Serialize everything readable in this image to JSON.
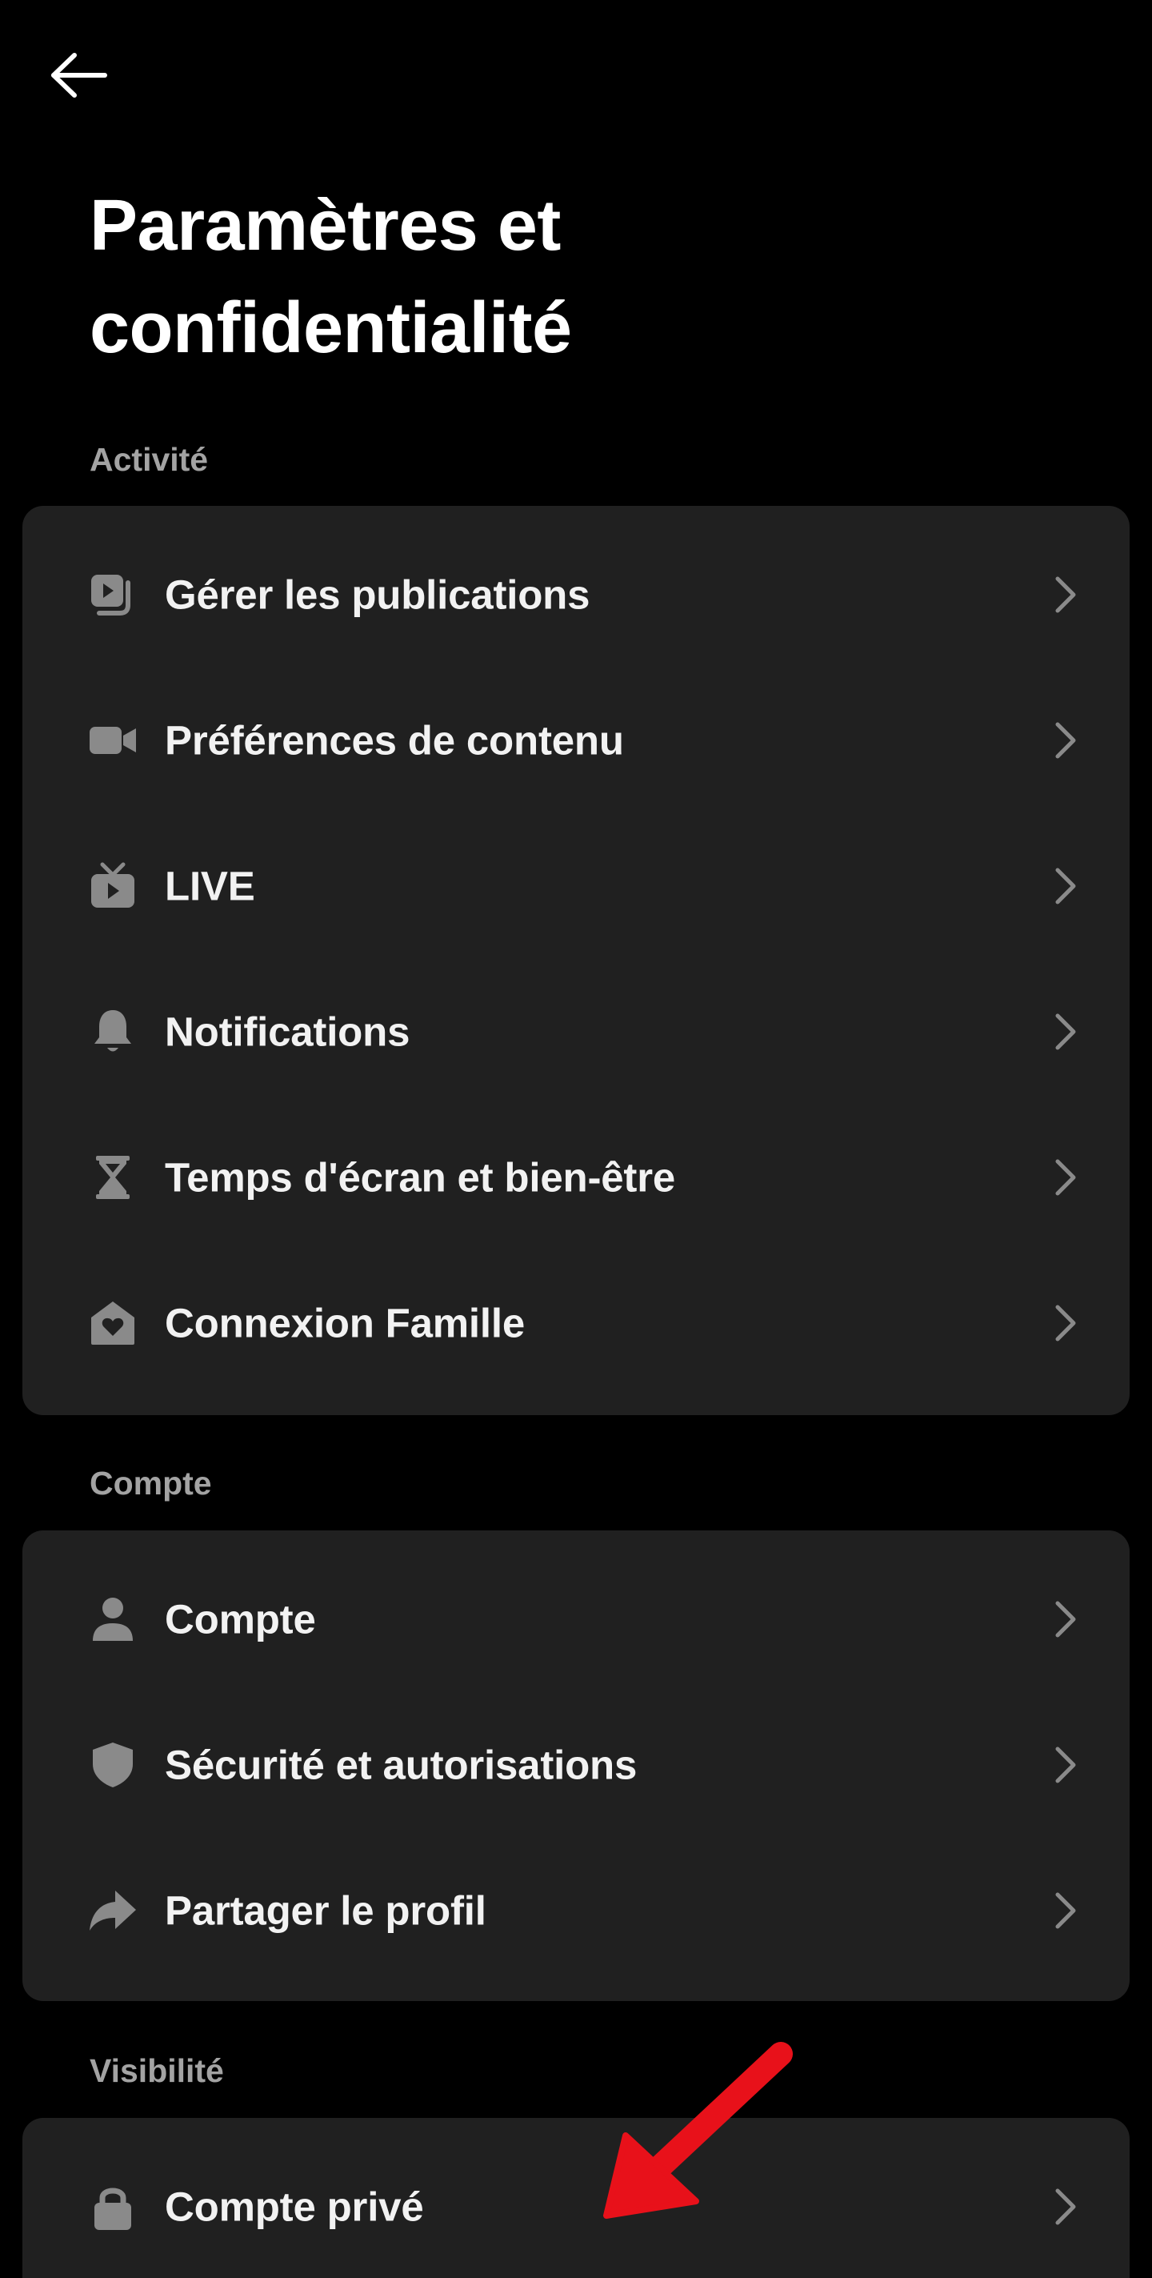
{
  "header": {
    "back_icon": "arrow-left-icon",
    "title": "Paramètres et confidentialité"
  },
  "sections": [
    {
      "label": "Activité",
      "items": [
        {
          "label": "Gérer les publications",
          "icon": "manage-posts-icon"
        },
        {
          "label": "Préférences de contenu",
          "icon": "video-camera-icon"
        },
        {
          "label": "LIVE",
          "icon": "tv-icon"
        },
        {
          "label": "Notifications",
          "icon": "bell-icon"
        },
        {
          "label": "Temps d'écran et bien-être",
          "icon": "hourglass-icon"
        },
        {
          "label": "Connexion Famille",
          "icon": "family-home-icon"
        }
      ]
    },
    {
      "label": "Compte",
      "items": [
        {
          "label": "Compte",
          "icon": "person-icon"
        },
        {
          "label": "Sécurité et autorisations",
          "icon": "shield-icon"
        },
        {
          "label": "Partager le profil",
          "icon": "share-icon"
        }
      ]
    },
    {
      "label": "Visibilité",
      "items": [
        {
          "label": "Compte privé",
          "icon": "lock-icon"
        }
      ]
    }
  ],
  "colors": {
    "background": "#000000",
    "card": "#202020",
    "section_label": "#a3a3a3",
    "row_text": "#f2f2f2",
    "icon": "#8a8a8a",
    "chevron": "#8a8a8a",
    "annotation_arrow": "#e8111a"
  }
}
